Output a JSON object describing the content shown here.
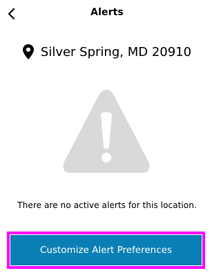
{
  "header": {
    "title": "Alerts",
    "back_icon": "chevron-left-icon"
  },
  "location": {
    "icon": "map-pin-icon",
    "text": "Silver Spring, MD 20910"
  },
  "empty_state": {
    "icon": "warning-triangle-icon",
    "message": "There are no active alerts for this location."
  },
  "cta": {
    "label": "Customize Alert Preferences",
    "highlighted": true
  },
  "colors": {
    "accent": "#0a7fb6",
    "highlight": "#ff00ff",
    "warning_icon": "#d9d9d9"
  }
}
